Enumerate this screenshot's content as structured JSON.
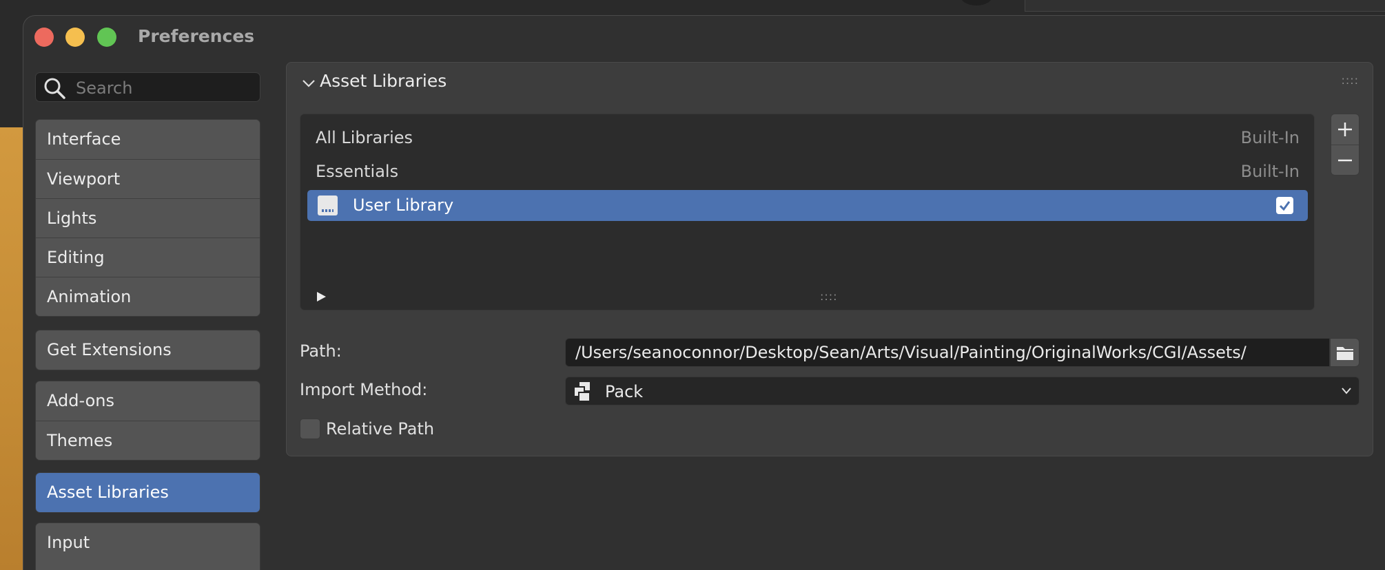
{
  "window": {
    "title": "Preferences"
  },
  "sidebar": {
    "search_placeholder": "Search",
    "groups": [
      {
        "items": [
          {
            "label": "Interface"
          },
          {
            "label": "Viewport"
          },
          {
            "label": "Lights"
          },
          {
            "label": "Editing"
          },
          {
            "label": "Animation"
          }
        ]
      },
      {
        "items": [
          {
            "label": "Get Extensions"
          }
        ]
      },
      {
        "items": [
          {
            "label": "Add-ons"
          },
          {
            "label": "Themes"
          }
        ]
      },
      {
        "items": [
          {
            "label": "Asset Libraries",
            "active": true
          }
        ]
      },
      {
        "items": [
          {
            "label": "Input"
          }
        ]
      }
    ]
  },
  "panel": {
    "title": "Asset Libraries",
    "grip": "::::",
    "libraries": [
      {
        "name": "All Libraries",
        "tag": "Built-In"
      },
      {
        "name": "Essentials",
        "tag": "Built-In"
      },
      {
        "name": "User Library",
        "selected": true,
        "enabled": true
      }
    ],
    "path_label": "Path:",
    "path_value": "/Users/seanoconnor/Desktop/Sean/Arts/Visual/Painting/OriginalWorks/CGI/Assets/",
    "import_method_label": "Import Method:",
    "import_method_value": "Pack",
    "relative_path_label": "Relative Path",
    "relative_path_checked": false
  },
  "colors": {
    "accent": "#4c72b0",
    "window_bg": "#303030",
    "panel_bg": "#3d3d3d"
  },
  "icons": [
    "search-icon",
    "chevron-down-icon",
    "drive-icon",
    "checkbox-checked-icon",
    "play-arrow-icon",
    "plus-icon",
    "minus-icon",
    "folder-icon",
    "pack-icon"
  ]
}
